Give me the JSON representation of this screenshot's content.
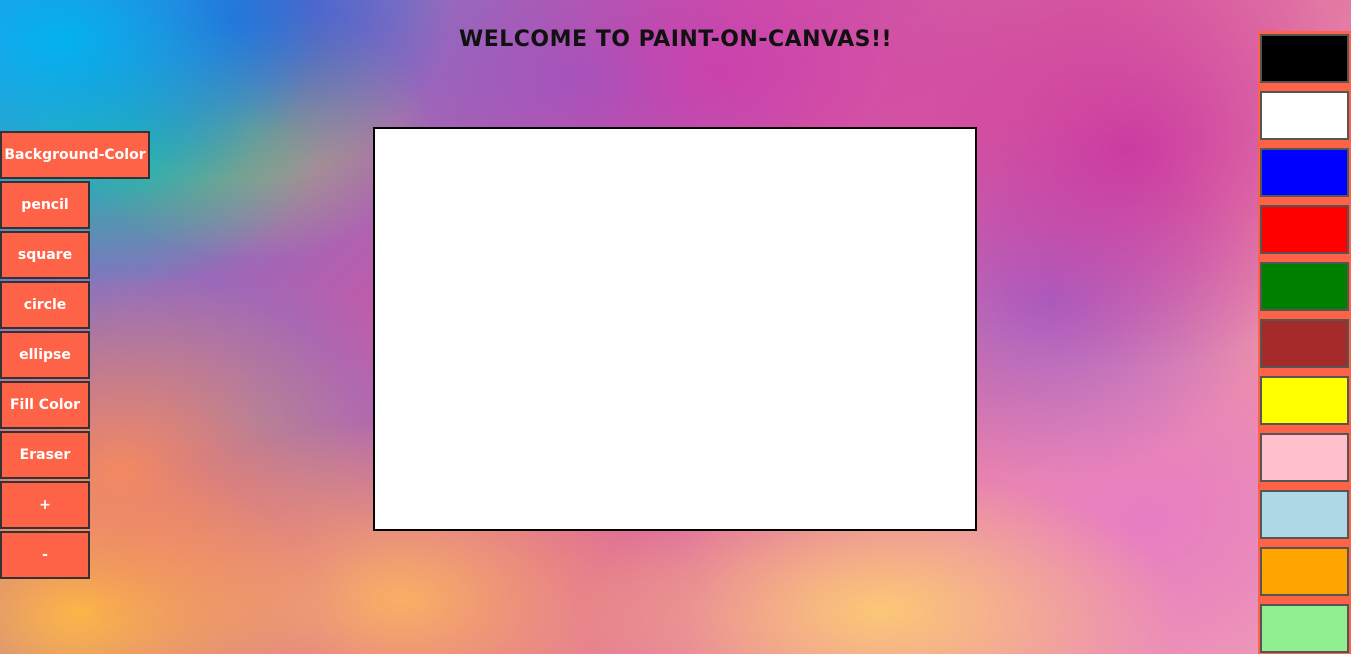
{
  "header": {
    "title": "WELCOME TO PAINT-ON-CANVAS!!"
  },
  "toolbar": {
    "background_color_label": "Background-Color",
    "pencil_label": "pencil",
    "square_label": "square",
    "circle_label": "circle",
    "ellipse_label": "ellipse",
    "fill_color_label": "Fill Color",
    "eraser_label": "Eraser",
    "increase_label": "+",
    "decrease_label": "-"
  },
  "theme": {
    "button_color": "#ff6347",
    "button_text_color": "#ffffff",
    "canvas_color": "#ffffff"
  },
  "palette": {
    "colors": [
      "#000000",
      "#ffffff",
      "#0000ff",
      "#ff0000",
      "#008000",
      "#a52a2a",
      "#ffff00",
      "#ffc0cb",
      "#add8e6",
      "#ffa500",
      "#90ee90"
    ],
    "color_names": [
      "black",
      "white",
      "blue",
      "red",
      "green",
      "brown",
      "yellow",
      "pink",
      "light-blue",
      "orange",
      "light-green"
    ]
  }
}
